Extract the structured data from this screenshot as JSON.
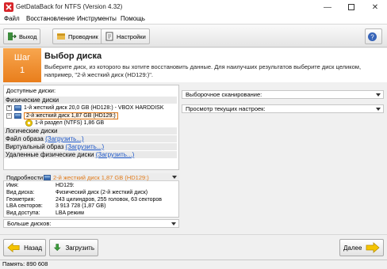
{
  "window": {
    "title": "GetDataBack for NTFS (Version 4.32)"
  },
  "menu": [
    "Файл",
    "Восстановление",
    "Инструменты",
    "Помощь"
  ],
  "toolbar": {
    "exit": "Выход",
    "explorer": "Проводник",
    "settings": "Настройки"
  },
  "step": {
    "label": "Шаг",
    "number": "1",
    "title": "Выбор диска",
    "description": "Выберите диск, из которого вы хотите восстановить данные. Для наилучших результатов выберите диск целиком, например, \"2-й жесткий диск (HD129:)\"."
  },
  "disks": {
    "available_label": "Доступные диски:",
    "physical_label": "Физические диски",
    "items": [
      "1-й жесткий диск 20,0 GB (HD128:) - VBOX HARDDISK",
      "2-й жесткий диск 1,87 GB (HD129:)",
      "1-й раздел (NTFS) 1,86 GB"
    ],
    "logical_label": "Логические диски",
    "image_label": "Файл образа",
    "image_link": "(Загрузить...)",
    "virtual_label": "Виртуальный образ",
    "virtual_link": "(Загрузить...)",
    "remote_label": "Удаленные физические диски",
    "remote_link": "(Загрузить...)"
  },
  "details": {
    "label": "Подробности:",
    "selected": "2-й жесткий диск 1,87 GB (HD129:)",
    "rows": [
      {
        "key": "Имя:",
        "value": "HD129:"
      },
      {
        "key": "Вид диска:",
        "value": "Физический диск (2-й жесткий диск)"
      },
      {
        "key": "Геометрия:",
        "value": "243 цилиндров, 255 головок, 63 секторов"
      },
      {
        "key": "LBA секторов:",
        "value": "3 913 728 (1,87 GB)"
      },
      {
        "key": "Вид доступа:",
        "value": "LBA режим"
      }
    ],
    "more": "Больше дисков:"
  },
  "right": {
    "scan": "Выборочное сканирование:",
    "settings_view": "Просмотр текущих настроек:"
  },
  "nav": {
    "back": "Назад",
    "load": "Загрузить",
    "next": "Далее"
  },
  "status": {
    "memory": "Память: 890 608"
  },
  "colors": {
    "accent": "#f39a3a",
    "link": "#1a55c8",
    "selected_disk": "#e07a1a"
  }
}
